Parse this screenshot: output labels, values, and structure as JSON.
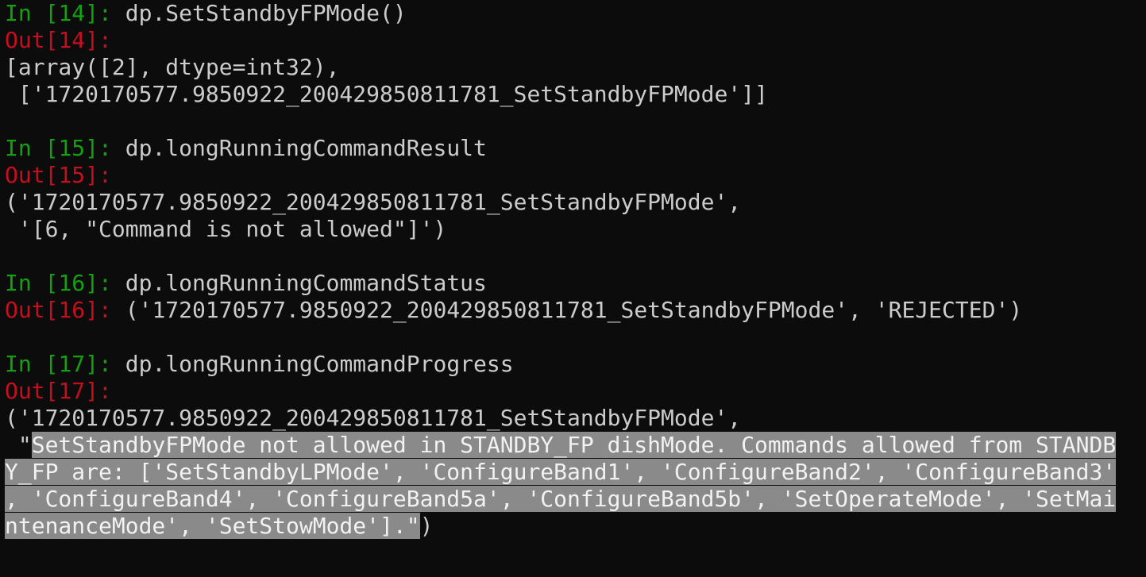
{
  "cells": [
    {
      "in_label": "In [",
      "in_num": "14",
      "in_close": "]: ",
      "code": "dp.SetStandbyFPMode()",
      "out_label": "Out[",
      "out_num": "14",
      "out_close": "]:",
      "output_lines": [
        "[array([2], dtype=int32),",
        " ['1720170577.9850922_200429850811781_SetStandbyFPMode']]"
      ]
    },
    {
      "in_label": "In [",
      "in_num": "15",
      "in_close": "]: ",
      "code": "dp.longRunningCommandResult",
      "out_label": "Out[",
      "out_num": "15",
      "out_close": "]:",
      "output_lines": [
        "('1720170577.9850922_200429850811781_SetStandbyFPMode',",
        " '[6, \"Command is not allowed\"]')"
      ]
    },
    {
      "in_label": "In [",
      "in_num": "16",
      "in_close": "]: ",
      "code": "dp.longRunningCommandStatus",
      "out_label": "Out[",
      "out_num": "16",
      "out_close": "]: ",
      "inline_output": "('1720170577.9850922_200429850811781_SetStandbyFPMode', 'REJECTED')"
    },
    {
      "in_label": "In [",
      "in_num": "17",
      "in_close": "]: ",
      "code": "dp.longRunningCommandProgress",
      "out_label": "Out[",
      "out_num": "17",
      "out_close": "]:",
      "output_line_1": "('1720170577.9850922_200429850811781_SetStandbyFPMode',",
      "sel_prefix": " \"",
      "sel_line_1": "SetStandbyFPMode not allowed in STANDBY_FP dishMode. Commands allowed from STANDB",
      "sel_line_2": "Y_FP are: ['SetStandbyLPMode', 'ConfigureBand1', 'ConfigureBand2', 'ConfigureBand3'",
      "sel_line_3": ", 'ConfigureBand4', 'ConfigureBand5a', 'ConfigureBand5b', 'SetOperateMode', 'SetMai",
      "sel_line_4": "ntenanceMode', 'SetStowMode'].\"",
      "sel_suffix": ")"
    }
  ]
}
